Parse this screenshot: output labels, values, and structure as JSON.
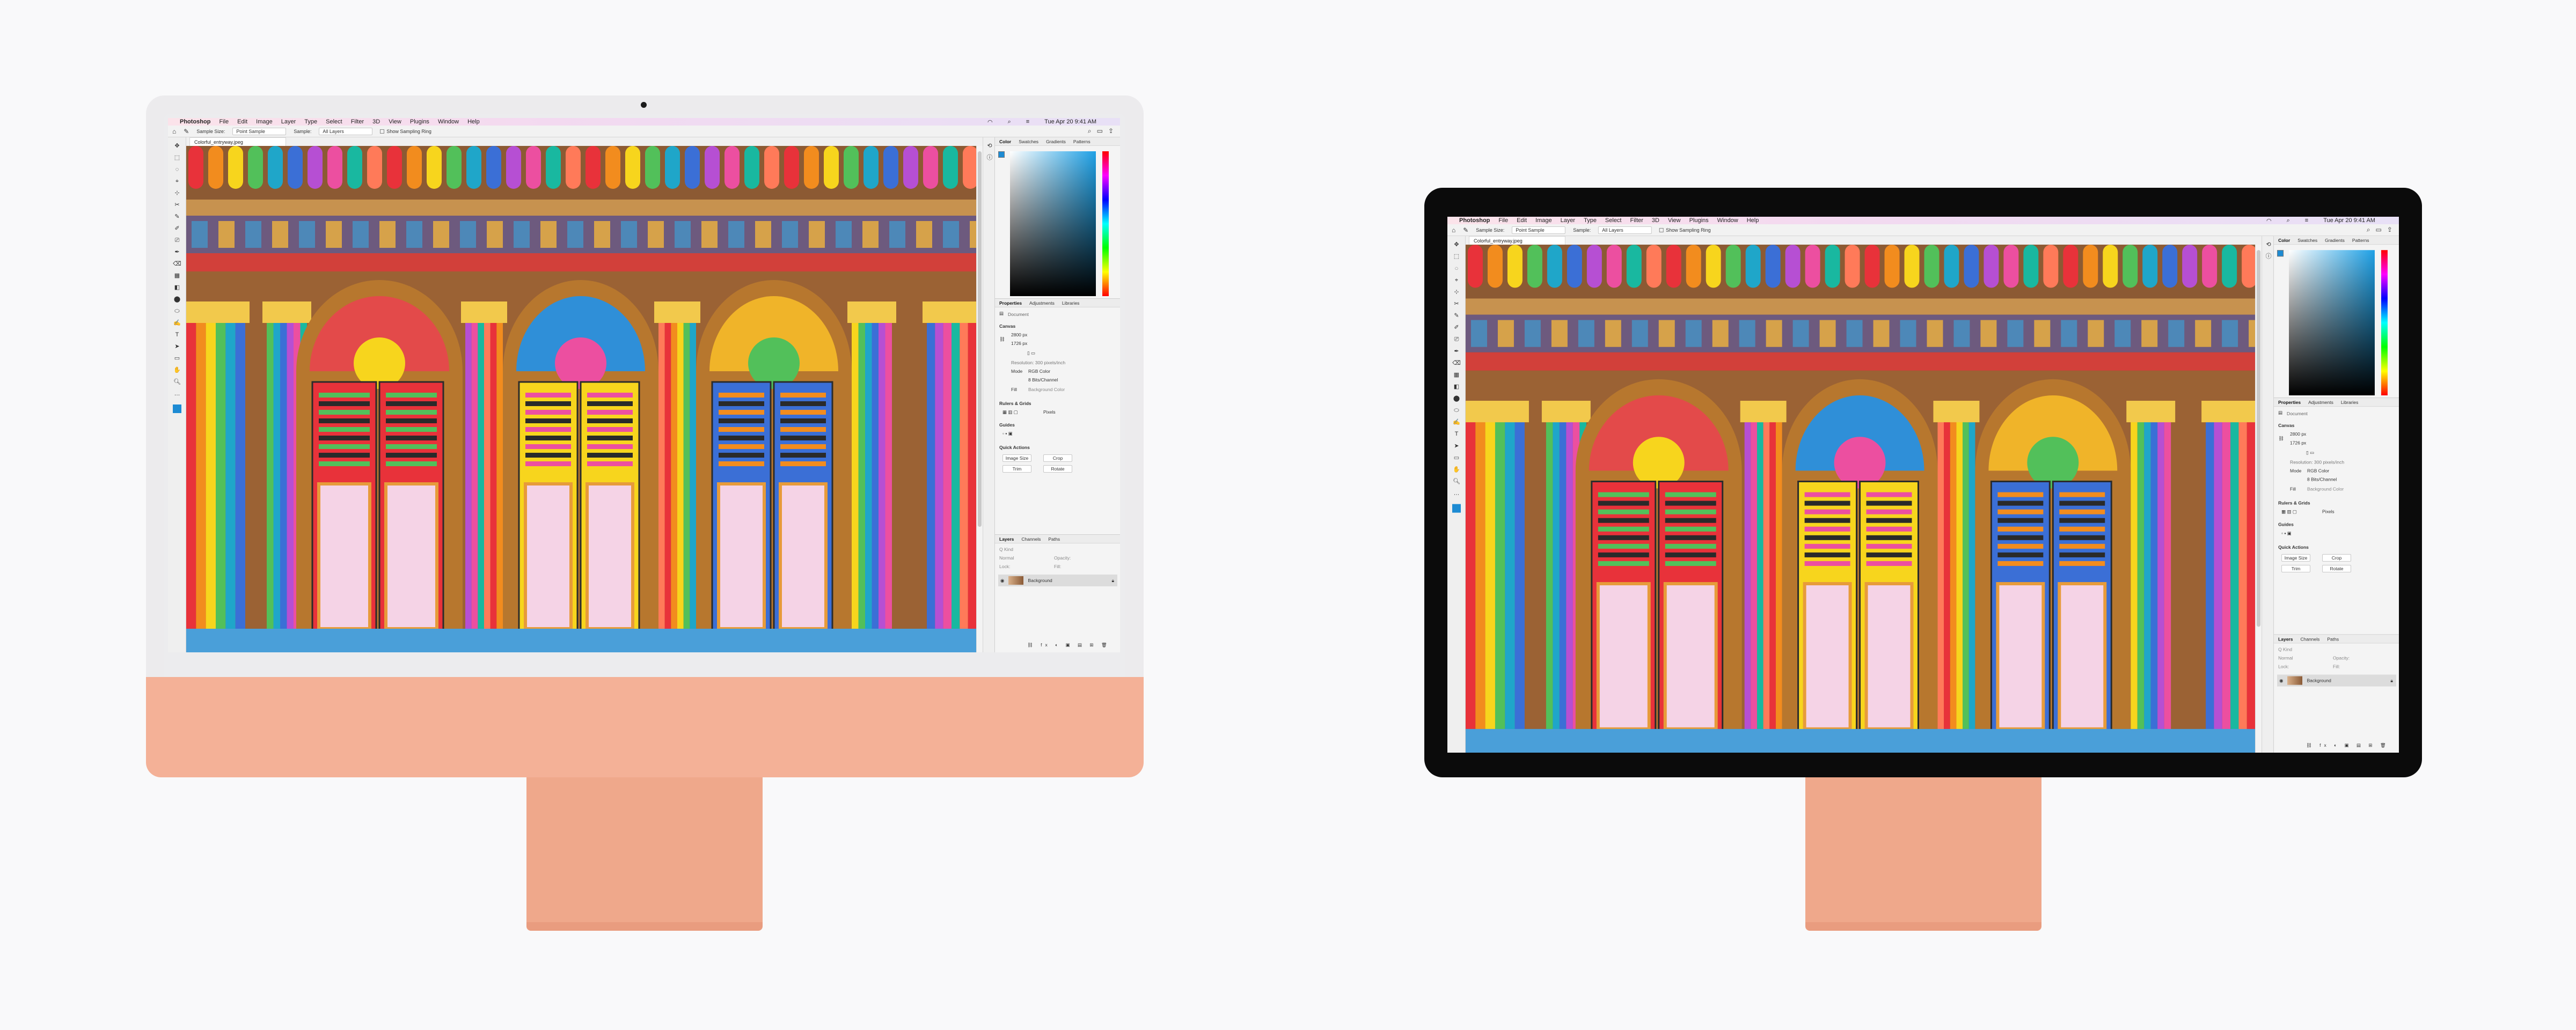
{
  "menu": {
    "apple": "",
    "app_name": "Photoshop",
    "items": [
      "File",
      "Edit",
      "Image",
      "Layer",
      "Type",
      "Select",
      "Filter",
      "3D",
      "View",
      "Plugins",
      "Window",
      "Help"
    ],
    "clock": "Tue Apr 20  9:41 AM"
  },
  "options_bar": {
    "sample_size_label": "Sample Size:",
    "sample_size_value": "Point Sample",
    "sample_label": "Sample:",
    "sample_value": "All Layers",
    "show_sampling_ring": "Show Sampling Ring"
  },
  "document": {
    "tab_title": "Colorful_entryway.jpeg"
  },
  "color_panel": {
    "tabs": [
      "Color",
      "Swatches",
      "Gradients",
      "Patterns"
    ],
    "foreground_color": "#1d8bd3"
  },
  "properties_panel": {
    "tabs": [
      "Properties",
      "Adjustments",
      "Libraries"
    ],
    "document_label": "Document",
    "canvas_section": "Canvas",
    "width": "2800 px",
    "height": "1726 px",
    "resolution": "Resolution: 300 pixels/inch",
    "mode_label": "Mode",
    "mode_value": "RGB Color",
    "bit_depth": "8 Bits/Channel",
    "fill_label": "Fill",
    "fill_value": "Background Color",
    "rulers_section": "Rulers & Grids",
    "units_value": "Pixels",
    "guides_section": "Guides",
    "quick_actions_section": "Quick Actions",
    "buttons": [
      "Image Size",
      "Crop",
      "Trim",
      "Rotate"
    ]
  },
  "layers_panel": {
    "tabs": [
      "Layers",
      "Channels",
      "Paths"
    ],
    "search_placeholder": "Q Kind",
    "blend_mode": "Normal",
    "opacity_label": "Opacity:",
    "lock_label": "Lock:",
    "fill_label": "Fill:",
    "layer_name": "Background"
  },
  "colors": {
    "imac_orange": "#f4b197",
    "menubar_tint": "#f3d9f0",
    "accent_blue": "#1d8bd3"
  }
}
